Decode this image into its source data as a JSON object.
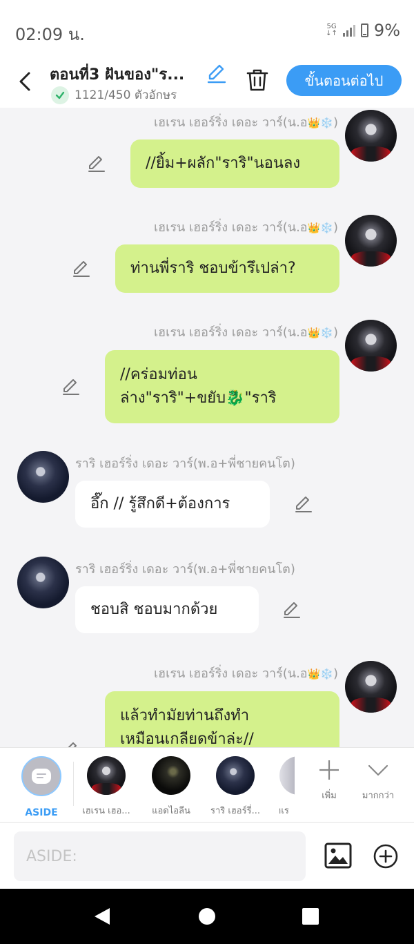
{
  "status_bar": {
    "time": "02:09 น.",
    "network": "5G",
    "network_sub": "↓↑",
    "battery": "9%"
  },
  "header": {
    "title": "ตอนที่3 ฝันของ\"ร...",
    "char_count": "1121/450 ตัวอักษร",
    "next_label": "ขั้นตอนต่อไป"
  },
  "messages": [
    {
      "side": "right",
      "character": "เฮเรน เฮอร์ริ่ง เดอะ วาร์(น.อ",
      "name_emoji": "👑❄️",
      "name_suffix": ")",
      "lines": [
        "//ยิ้ม+ผลัก\"ราริ\"นอนลง"
      ]
    },
    {
      "side": "right",
      "character": "เฮเรน เฮอร์ริ่ง เดอะ วาร์(น.อ",
      "name_emoji": "👑❄️",
      "name_suffix": ")",
      "lines": [
        "ท่านพี่ราริ ชอบข้ารึเปล่า?"
      ]
    },
    {
      "side": "right",
      "character": "เฮเรน เฮอร์ริ่ง เดอะ วาร์(น.อ",
      "name_emoji": "👑❄️",
      "name_suffix": ")",
      "lines": [
        "//คร่อมท่อน",
        "ล่าง\"ราริ\"+ขยับ🐉\"ราริ"
      ]
    },
    {
      "side": "left",
      "character": "ราริ เฮอร์ริ่ง เดอะ วาร์(พ.อ+พี่ชายคนโต)",
      "lines": [
        "อึ๊ก // รู้สึกดี+ต้องการ"
      ]
    },
    {
      "side": "left",
      "character": "ราริ เฮอร์ริ่ง เดอะ วาร์(พ.อ+พี่ชายคนโต)",
      "lines": [
        "ชอบสิ ชอบมากด้วย"
      ]
    },
    {
      "side": "right",
      "character": "เฮเรน เฮอร์ริ่ง เดอะ วาร์(น.อ",
      "name_emoji": "👑❄️",
      "name_suffix": ")",
      "lines": [
        "แล้วทำมัยท่านถึงทำ",
        "เหมือนเกลียดข้าล่ะ//"
      ]
    }
  ],
  "characters": [
    {
      "label": "ASIDE",
      "icon": "aside-icon",
      "selected": true
    },
    {
      "label": "เฮเรน เฮอ...",
      "icon": "heren-avatar"
    },
    {
      "label": "แอดไอลีน",
      "icon": "admin-avatar"
    },
    {
      "label": "ราริ เฮอร์รี่...",
      "icon": "rari-avatar"
    },
    {
      "label": "เฮเร",
      "icon": "partial-avatar"
    }
  ],
  "tools": {
    "add_label": "เพิ่ม",
    "more_label": "มากกว่า"
  },
  "input": {
    "value": "",
    "placeholder": "ASIDE:"
  },
  "colors": {
    "accent": "#3b9cf5",
    "bubble_right": "#d4f18c",
    "bubble_left": "#ffffff",
    "background": "#f4f4f6"
  }
}
